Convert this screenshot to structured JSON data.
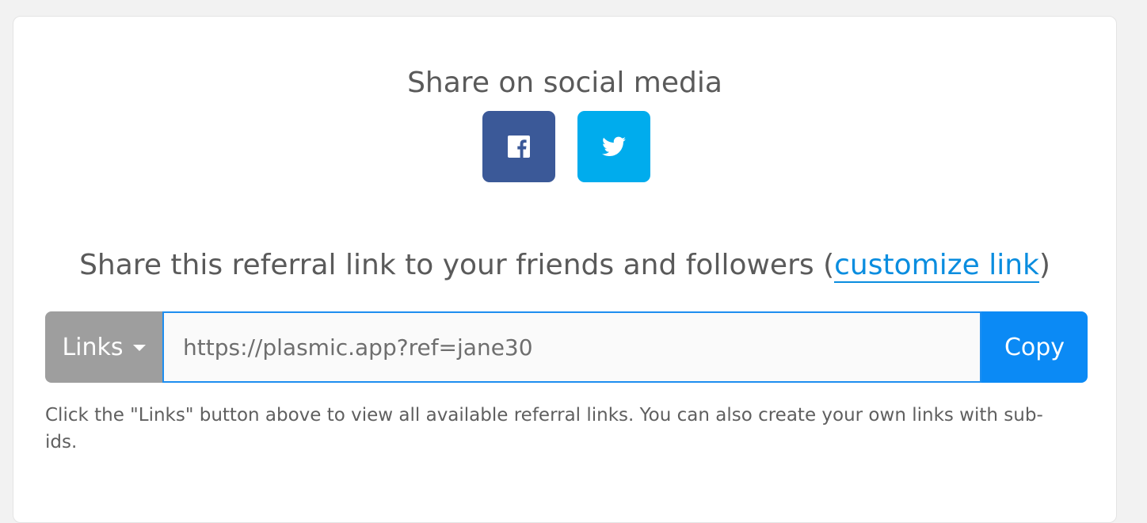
{
  "social": {
    "title": "Share on social media",
    "buttons": [
      {
        "name": "facebook",
        "icon": "facebook-icon",
        "color": "#3b5998"
      },
      {
        "name": "twitter",
        "icon": "twitter-icon",
        "color": "#00aced"
      }
    ]
  },
  "referral": {
    "title_prefix": "Share this referral link to your friends and followers (",
    "customize_label": "customize link",
    "title_suffix": ")",
    "dropdown_label": "Links",
    "link_value": "https://plasmic.app?ref=jane30",
    "copy_label": "Copy",
    "help_text": "Click the \"Links\" button above to view all available referral links. You can also create your own links with sub-ids."
  },
  "colors": {
    "accent": "#0b8af5",
    "link": "#0a8ddf",
    "dropdown_bg": "#9e9e9e",
    "text": "#5a5a5a"
  }
}
